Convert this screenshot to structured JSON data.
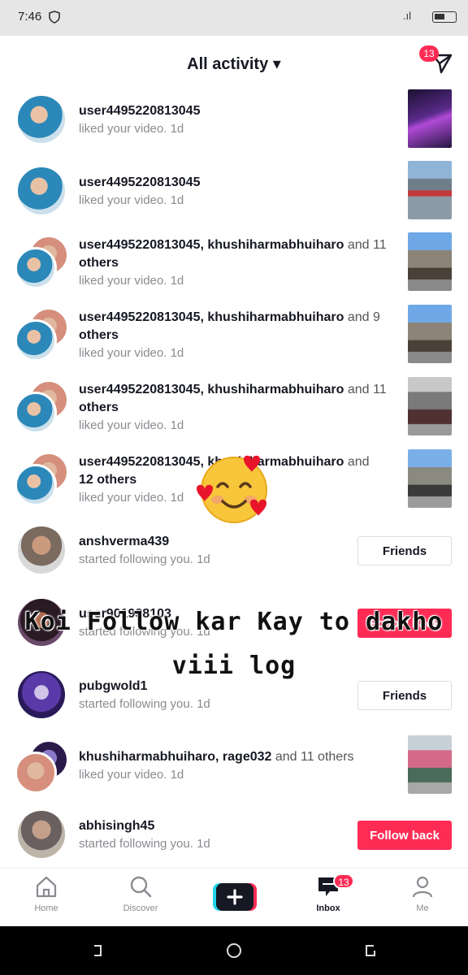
{
  "status": {
    "time": "7:46",
    "signal": ".ıl"
  },
  "header": {
    "title": "All activity ▾",
    "dm_badge": "13"
  },
  "rows": [
    {
      "users": "user4495220813045",
      "joiner": "",
      "more": "",
      "action": "liked your video.",
      "age": "1d"
    },
    {
      "users": "user4495220813045",
      "joiner": "",
      "more": "",
      "action": "liked your video.",
      "age": "1d"
    },
    {
      "users": "user4495220813045, khushiharmabhuiharo",
      "joiner": " and 11",
      "more": "others",
      "action": "liked your video.",
      "age": "1d"
    },
    {
      "users": "user4495220813045, khushiharmabhuiharo",
      "joiner": " and 9",
      "more": "others",
      "action": "liked your video.",
      "age": "1d"
    },
    {
      "users": "user4495220813045, khushiharmabhuiharo",
      "joiner": " and 11",
      "more": "others",
      "action": "liked your video.",
      "age": "1d"
    },
    {
      "users": "user4495220813045, khushiharmabhuiharo",
      "joiner": " and",
      "more": "12 others",
      "action": "liked your video.",
      "age": "1d"
    },
    {
      "users": "anshverma439",
      "action": "started following you.",
      "age": "1d",
      "button": "Friends"
    },
    {
      "users": "user901938103",
      "action": "started following you.",
      "age": "1d",
      "button": "Follow back"
    },
    {
      "users": "pubgwold1",
      "action": "started following you.",
      "age": "1d",
      "button": "Friends"
    },
    {
      "users": "khushiharmabhuiharo, rage032",
      "joiner": " and 11 others",
      "action": "liked your video.",
      "age": "1d"
    },
    {
      "users": "abhisingh45",
      "action": "started following you.",
      "age": "1d",
      "button": "Follow back"
    }
  ],
  "overlay": {
    "line1": "Koi Follow kar Kay to dakho",
    "line2": "viii log"
  },
  "nav": {
    "home": "Home",
    "discover": "Discover",
    "inbox": "Inbox",
    "inbox_badge": "13",
    "me": "Me"
  },
  "colors": {
    "accent": "#fe2c55",
    "text": "#161823",
    "muted": "#8a8b91"
  }
}
